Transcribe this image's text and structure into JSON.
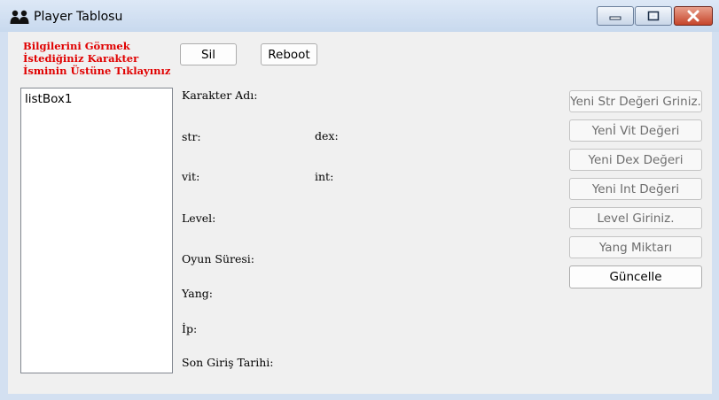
{
  "window": {
    "title": "Player Tablosu",
    "icon": "users-icon",
    "controls": [
      "minimize-icon",
      "maximize-icon",
      "close-icon"
    ]
  },
  "note": {
    "line1": "Bilgilerini Görmek",
    "line2": "İstediğiniz Karakter",
    "line3": "İsminin Üstüne Tıklayınız",
    "color": "#e00000"
  },
  "buttons": {
    "sil": "Sil",
    "reboot": "Reboot"
  },
  "listbox": {
    "items": [
      "listBox1"
    ]
  },
  "labels": {
    "karakter_adi": "Karakter Adı:",
    "str": "str:",
    "dex": "dex:",
    "vit": "vit:",
    "int": "int:",
    "level": "Level:",
    "oyun_suresi": "Oyun Süresi:",
    "yang": "Yang:",
    "ip": "İp:",
    "son_giris": "Son Giriş Tarihi:"
  },
  "inputs": {
    "str": "Yeni Str Değeri Griniz.",
    "vit": "Yenİ Vit Değeri",
    "dex": "Yeni Dex Değeri",
    "int": "Yeni Int Değeri",
    "level": "Level Giriniz.",
    "yang": "Yang Miktarı"
  },
  "update_button": "Güncelle"
}
